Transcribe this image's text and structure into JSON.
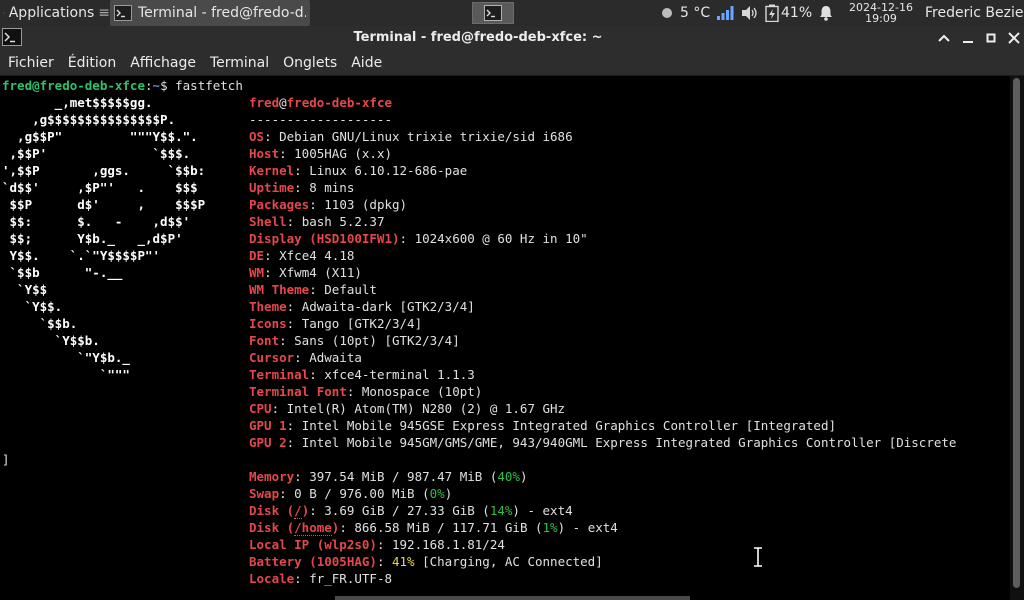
{
  "panel": {
    "apps_label": "Applications",
    "task_label": "Terminal - fred@fredo-d...",
    "weather": "5 °C",
    "battery": "41%",
    "clock_date": "2024-12-16",
    "clock_time": "19:09",
    "user": "Frederic Bezies",
    "icons": [
      "xfce-mouse-icon",
      "terminal-icon",
      "network-signal-icon",
      "volume-icon",
      "battery-icon",
      "bell-icon"
    ]
  },
  "window": {
    "title": "Terminal - fred@fredo-deb-xfce: ~"
  },
  "menu": [
    "Fichier",
    "Édition",
    "Affichage",
    "Terminal",
    "Onglets",
    "Aide"
  ],
  "prompt": {
    "user_host": "fred@fredo-deb-xfce",
    "path": "~",
    "symbol": "$",
    "command": "fastfetch"
  },
  "logo": [
    "       _,met$$$$$gg.",
    "    ,g$$$$$$$$$$$$$$$P.",
    "  ,g$$P\"         \"\"\"Y$$.\".",
    " ,$$P'              `$$$.",
    "',$$P       ,ggs.     `$$b:",
    "`d$$'     ,$P\"'   .    $$$",
    " $$P      d$'     ,    $$$P",
    " $$:      $.   -    ,d$$'",
    " $$;      Y$b._   _,d$P'",
    " Y$$.    `.`\"Y$$$$P\"'",
    " `$$b      \"-.__",
    "  `Y$$",
    "   `Y$$.",
    "     `$$b.",
    "       `Y$$b.",
    "          `\"Y$b._",
    "             `\"\"\""
  ],
  "info": {
    "header_user": "fred",
    "header_at": "@",
    "header_host": "fredo-deb-xfce",
    "separator": "-------------------",
    "rows": [
      {
        "key": "OS",
        "value": ": Debian GNU/Linux trixie trixie/sid i686"
      },
      {
        "key": "Host",
        "value": ": 1005HAG (x.x)"
      },
      {
        "key": "Kernel",
        "value": ": Linux 6.10.12-686-pae"
      },
      {
        "key": "Uptime",
        "value": ": 8 mins"
      },
      {
        "key": "Packages",
        "value": ": 1103 (dpkg)"
      },
      {
        "key": "Shell",
        "value": ": bash 5.2.37"
      },
      {
        "key": "Display (HSD100IFW1)",
        "value": ": 1024x600 @ 60 Hz in 10\""
      },
      {
        "key": "DE",
        "value": ": Xfce4 4.18"
      },
      {
        "key": "WM",
        "value": ": Xfwm4 (X11)"
      },
      {
        "key": "WM Theme",
        "value": ": Default"
      },
      {
        "key": "Theme",
        "value": ": Adwaita-dark [GTK2/3/4]"
      },
      {
        "key": "Icons",
        "value": ": Tango [GTK2/3/4]"
      },
      {
        "key": "Font",
        "value": ": Sans (10pt) [GTK2/3/4]"
      },
      {
        "key": "Cursor",
        "value": ": Adwaita"
      },
      {
        "key": "Terminal",
        "value": ": xfce4-terminal 1.1.3"
      },
      {
        "key": "Terminal Font",
        "value": ": Monospace (10pt)"
      },
      {
        "key": "CPU",
        "value": ": Intel(R) Atom(TM) N280 (2) @ 1.67 GHz"
      },
      {
        "key": "GPU 1",
        "value": ": Intel Mobile 945GSE Express Integrated Graphics Controller [Integrated]"
      },
      {
        "key": "GPU 2",
        "value": ": Intel Mobile 945GM/GMS/GME, 943/940GML Express Integrated Graphics Controller [Discrete"
      }
    ],
    "wrap_char": "]",
    "memory": {
      "key": "Memory",
      "pre": ": 397.54 MiB / 987.47 MiB (",
      "pct": "40%",
      "post": ")"
    },
    "swap": {
      "key": "Swap",
      "pre": ": 0 B / 976.00 MiB (",
      "pct": "0%",
      "post": ")"
    },
    "disk1": {
      "key_a": "Disk (",
      "key_b": "/",
      "key_c": ")",
      "pre": ": 3.69 GiB / 27.33 GiB (",
      "pct": "14%",
      "post": ") - ext4"
    },
    "disk2": {
      "key_a": "Disk (",
      "key_b": "/home",
      "key_c": ")",
      "pre": ": 866.58 MiB / 117.71 GiB (",
      "pct": "1%",
      "post": ") - ext4"
    },
    "localip": {
      "key": "Local IP (wlp2s0)",
      "value": ": 192.168.1.81/24"
    },
    "battery": {
      "key": "Battery (1005HAG)",
      "pre": ": ",
      "pct": "41%",
      "post": " [Charging, AC Connected]"
    },
    "locale": {
      "key": "Locale",
      "value": ": fr_FR.UTF-8"
    }
  },
  "colors": {
    "accent_red": "#e5474c",
    "prompt_green": "#2fc26b",
    "path_blue": "#4f8fd6",
    "percent_green": "#2fbf4a",
    "percent_yellow": "#e7d94a"
  }
}
